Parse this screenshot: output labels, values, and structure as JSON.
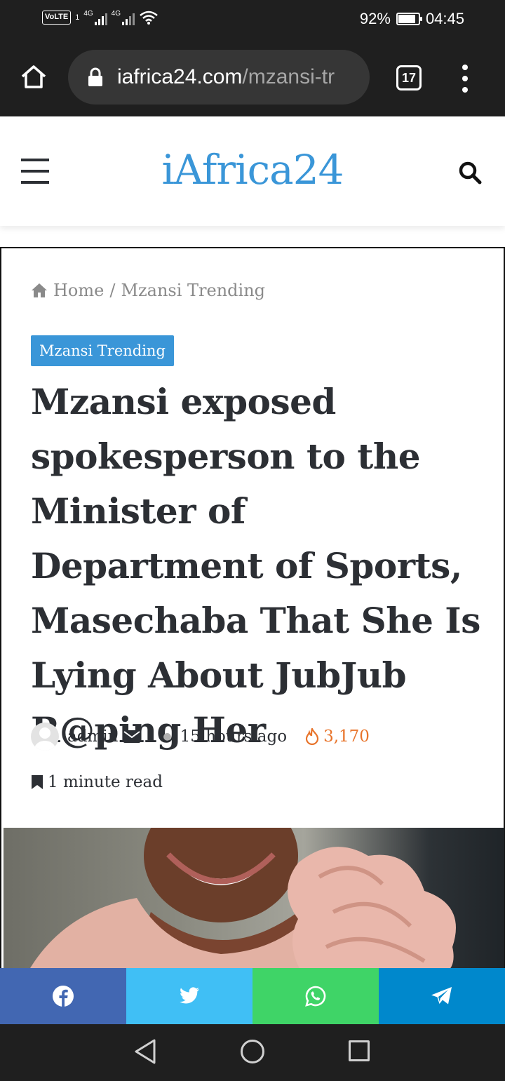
{
  "status_bar": {
    "volte": "VoLTE",
    "sim1": "1",
    "net1": "4G",
    "net2": "4G",
    "battery_text": "92%",
    "battery_level": 0.92,
    "time": "04:45"
  },
  "browser": {
    "url_domain": "iafrica24.com",
    "url_path": "/mzansi-tr",
    "tab_count": "17"
  },
  "site": {
    "logo": "iAfrica24"
  },
  "breadcrumb": {
    "home": "Home",
    "separator": "/",
    "current": "Mzansi Trending"
  },
  "article": {
    "category": "Mzansi Trending",
    "title": "Mzansi exposed spokesperson to the Minister of Department of Sports, Masechaba That She Is Lying About JubJub R@ping Her",
    "author": "admin",
    "time_ago": "15 hours ago",
    "views": "3,170",
    "read_time": "1 minute read"
  },
  "share": [
    "facebook",
    "twitter",
    "whatsapp",
    "telegram"
  ],
  "colors": {
    "brand": "#3a96d8",
    "views": "#e8742b",
    "facebook": "#4267b2",
    "twitter": "#40bff5",
    "whatsapp": "#3fd467",
    "telegram": "#0088cc"
  }
}
